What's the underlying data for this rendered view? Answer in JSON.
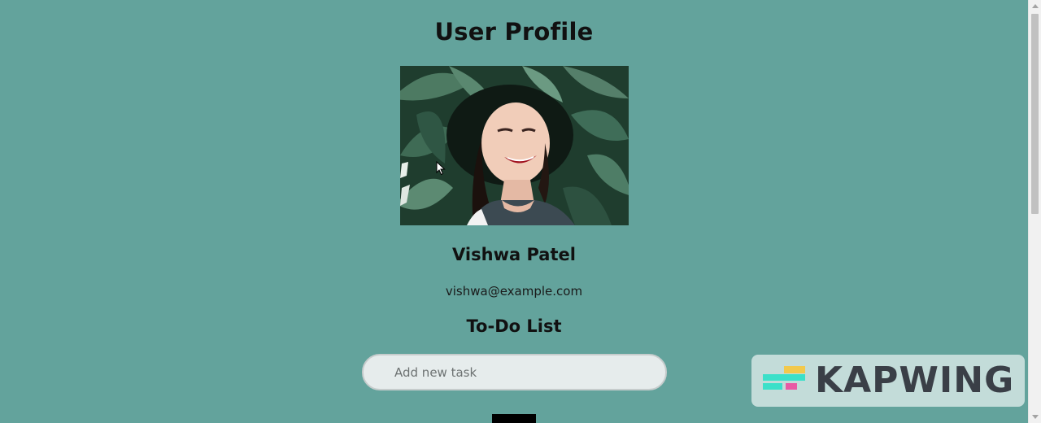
{
  "page": {
    "title": "User Profile",
    "background_color": "#63a39c"
  },
  "profile": {
    "photo_description_icon": "profile-photo",
    "name": "Vishwa Patel",
    "email": "vishwa@example.com"
  },
  "todo": {
    "title": "To-Do List",
    "input_placeholder": "Add new task",
    "input_value": ""
  },
  "watermark": {
    "text": "KAPWING"
  }
}
